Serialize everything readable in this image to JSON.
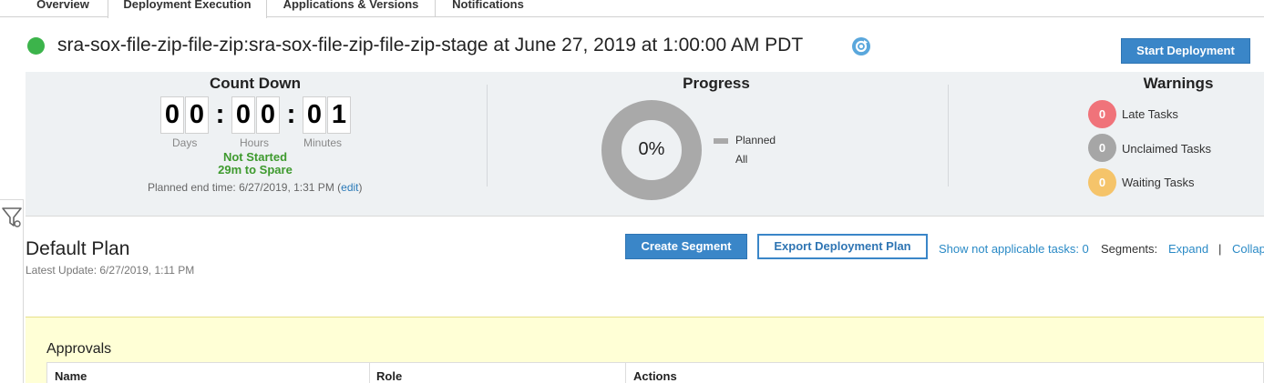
{
  "tabs": [
    "Overview",
    "Deployment Execution",
    "Applications & Versions",
    "Notifications"
  ],
  "header": {
    "title": "sra-sox-file-zip-file-zip:sra-sox-file-zip-file-zip-stage at June 27, 2019 at 1:00:00 AM PDT",
    "start_button": "Start Deployment",
    "status_color": "#3cb44b"
  },
  "countdown": {
    "title": "Count Down",
    "digits": [
      "0",
      "0",
      "0",
      "0",
      "0",
      "1"
    ],
    "separator": ":",
    "units": [
      "Days",
      "Hours",
      "Minutes"
    ],
    "status": "Not Started",
    "spare": "29m to Spare",
    "planned_end_prefix": "Planned end time: 6/27/2019, 1:31 PM (",
    "edit_label": "edit",
    "planned_end_suffix": ")"
  },
  "progress": {
    "title": "Progress",
    "percent_label": "0%",
    "percent": 0,
    "legend": "Planned",
    "filter_label": "All"
  },
  "warnings": {
    "title": "Warnings",
    "items": [
      {
        "count": "0",
        "label": "Late Tasks",
        "color": "#f0737a"
      },
      {
        "count": "0",
        "label": "Unclaimed Tasks",
        "color": "#a6a6a6"
      },
      {
        "count": "0",
        "label": "Waiting Tasks",
        "color": "#f5c46a"
      }
    ]
  },
  "plan": {
    "title": "Default Plan",
    "updated": "Latest Update: 6/27/2019, 1:11 PM",
    "create_segment": "Create Segment",
    "export_plan": "Export Deployment Plan",
    "show_na": "Show not applicable tasks: 0",
    "segments_label": "Segments:",
    "expand": "Expand",
    "separator": "|",
    "collapse": "Collap"
  },
  "approvals": {
    "title": "Approvals",
    "columns": [
      "Name",
      "Role",
      "Actions"
    ]
  }
}
